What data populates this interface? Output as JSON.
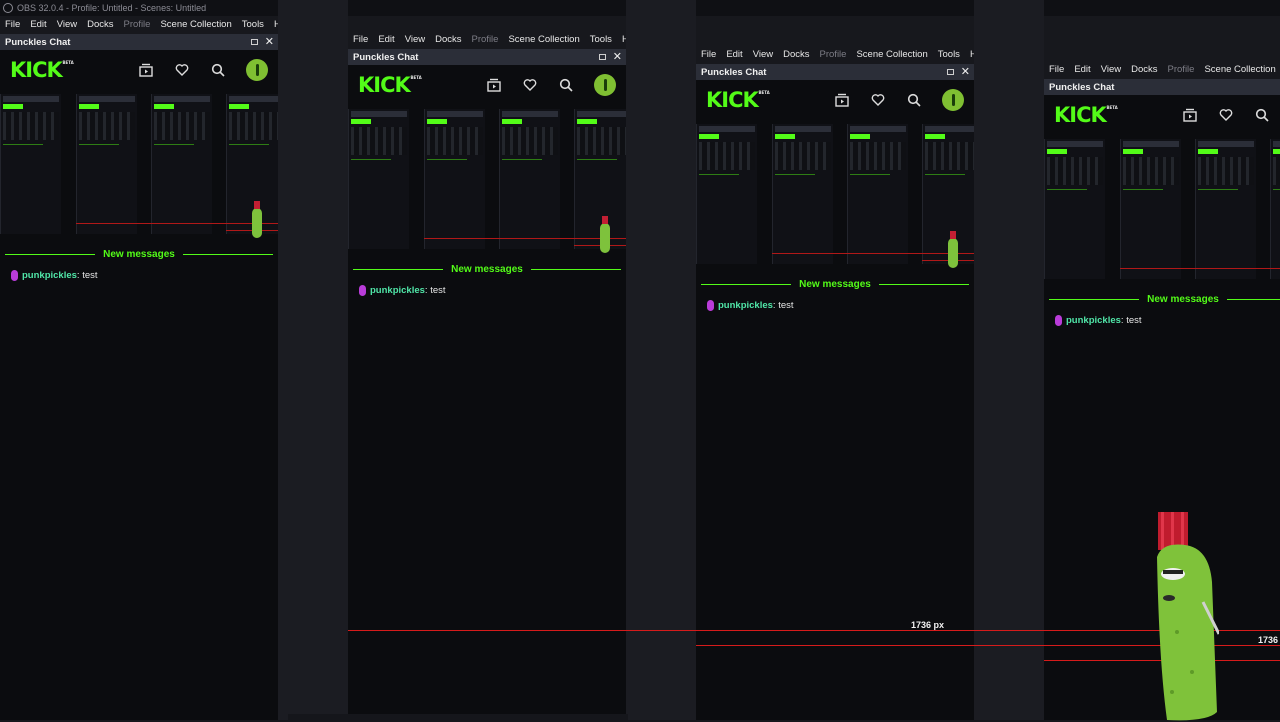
{
  "window": {
    "title": "OBS 32.0.4 - Profile: Untitled - Scenes: Untitled"
  },
  "menu": {
    "file": "File",
    "edit": "Edit",
    "view": "View",
    "docks": "Docks",
    "profile": "Profile",
    "scene_collection": "Scene Collection",
    "tools": "Tools",
    "help": "Help",
    "partial_tools": "To"
  },
  "dock": {
    "title": "Punckles Chat"
  },
  "kick": {
    "logo": "KICK",
    "beta": "BETA",
    "icons": [
      "browse-icon",
      "heart-icon",
      "search-icon",
      "avatar"
    ],
    "accent": "#53fc18"
  },
  "chat": {
    "divider": "New messages",
    "username": "punkpickles",
    "separator": ":",
    "message": " test",
    "username_color": "#50e6a8",
    "badge_color": "#b93cd9"
  },
  "measure": {
    "label": "1736 px",
    "label_cut": "1736"
  },
  "colors": {
    "background": "#17181d",
    "panel": "#0b0c0f",
    "header": "#2b2e38",
    "red_line": "#d61b1b"
  }
}
